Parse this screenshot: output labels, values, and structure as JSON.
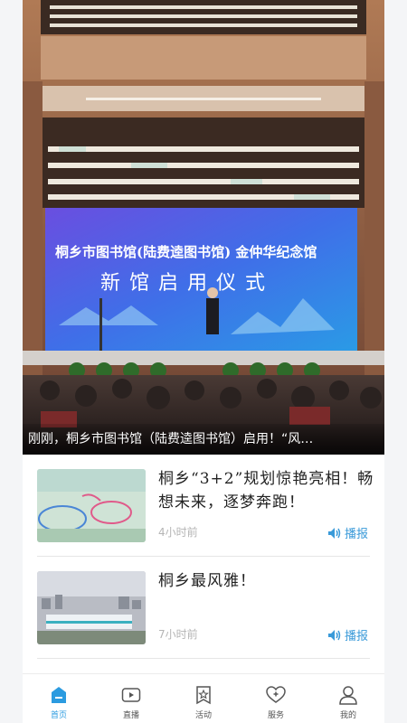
{
  "hero": {
    "screen_title_line1": "桐乡市图书馆(陆费逵图书馆)  金仲华纪念馆",
    "screen_title_line2": "新馆启用仪式",
    "caption": "刚刚，桐乡市图书馆（陆费逵图书馆）启用！“风…"
  },
  "news": [
    {
      "title": "桐乡“3+2”规划惊艳亮相！畅想未来，逐梦奔跑！",
      "time": "4小时前",
      "speak_label": "播报"
    },
    {
      "title": "桐乡最风雅！",
      "time": "7小时前",
      "speak_label": "播报"
    }
  ],
  "tabs": [
    {
      "label": "首页",
      "icon": "home-icon",
      "active": true
    },
    {
      "label": "直播",
      "icon": "live-video-icon",
      "active": false
    },
    {
      "label": "活动",
      "icon": "activity-star-icon",
      "active": false
    },
    {
      "label": "服务",
      "icon": "service-heart-icon",
      "active": false
    },
    {
      "label": "我的",
      "icon": "profile-icon",
      "active": false
    }
  ],
  "colors": {
    "accent": "#2b9be0",
    "speak": "#3a9ad9",
    "screen_blue": "#4a6fe0"
  }
}
